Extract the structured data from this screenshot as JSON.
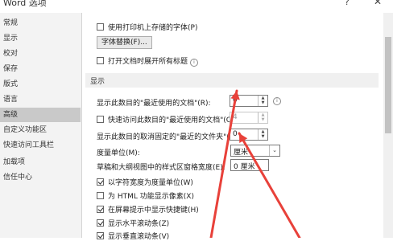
{
  "window": {
    "title": "Word 选项",
    "help": "?",
    "close": "✕"
  },
  "sidebar": {
    "items": [
      {
        "label": "常规"
      },
      {
        "label": "显示"
      },
      {
        "label": "校对"
      },
      {
        "label": "保存"
      },
      {
        "label": "版式"
      },
      {
        "label": "语言"
      },
      {
        "label": "高级"
      },
      {
        "label": "自定义功能区"
      },
      {
        "label": "快速访问工具栏"
      },
      {
        "label": "加载项"
      },
      {
        "label": "信任中心"
      }
    ],
    "selected_index": 6
  },
  "options_top": {
    "use_printer_fonts": "使用打印机上存储的字体(P)",
    "font_substitution_button": "字体替换(F)...",
    "expand_headings": "打开文档时展开所有标题"
  },
  "display_section": {
    "title": "显示",
    "recent_docs_label": "显示此数目的\"最近使用的文档\"(R):",
    "recent_docs_value": "0",
    "quick_access_label": "快速访问此数目的\"最近使用的文档\"(Q):",
    "quick_access_value": "4",
    "unpinned_folders_label": "显示此数目的取消固定的\"最近的文件夹\"(F):",
    "unpinned_folders_value": "0",
    "units_label": "度量单位(M):",
    "units_value": "厘米",
    "style_area_label": "草稿和大纲视图中的样式区窗格宽度(E):",
    "style_area_value": "0 厘米",
    "char_width_units": "以字符宽度为度量单位(W)",
    "html_pixels": "为 HTML 功能显示像素(X)",
    "shortcut_keys": "在屏幕提示中显示快捷键(H)",
    "horizontal_scroll": "显示水平滚动条(Z)",
    "vertical_scroll": "显示垂直滚动条(V)"
  },
  "colors": {
    "arrow": "#e8413a",
    "selected_nav": "#c9c9c9"
  }
}
